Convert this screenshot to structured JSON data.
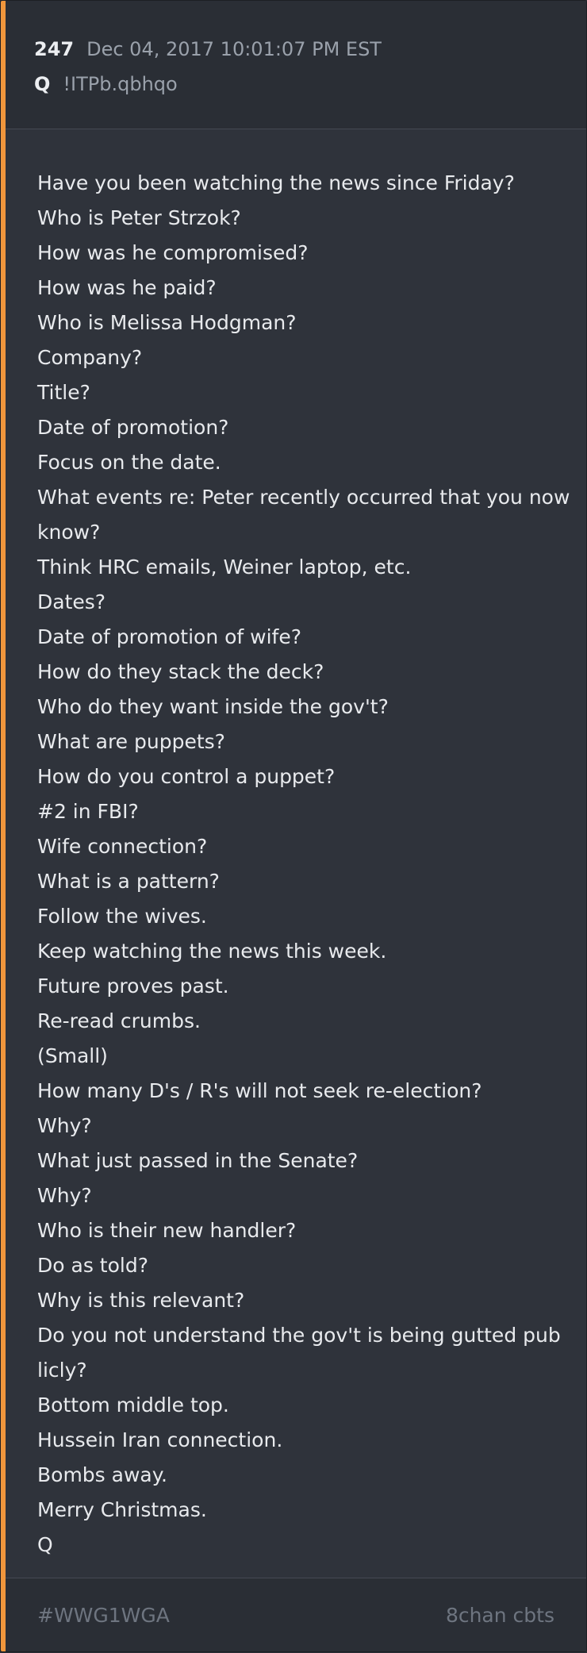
{
  "post": {
    "number": "247",
    "timestamp": "Dec 04, 2017 10:01:07 PM EST",
    "author": "Q",
    "tripcode": "!ITPb.qbhqo",
    "lines": [
      "Have you been watching the news since Friday?",
      "Who is Peter Strzok?",
      "How was he compromised?",
      "How was he paid?",
      "Who is Melissa Hodgman?",
      "Company?",
      "Title?",
      "Date of promotion?",
      "Focus on the date.",
      "What events re: Peter recently occurred that you now",
      "know?",
      "Think HRC emails, Weiner laptop, etc.",
      "Dates?",
      "Date of promotion of wife?",
      "How do they stack the deck?",
      "Who do they want inside the gov't?",
      "What are puppets?",
      "How do you control a puppet?",
      "#2 in FBI?",
      "Wife connection?",
      "What is a pattern?",
      "Follow the wives.",
      "Keep watching the news this week.",
      "Future proves past.",
      "Re-read crumbs.",
      "(Small)",
      "How many D's / R's will not seek re-election?",
      "Why?",
      "What just passed in the Senate?",
      "Why?",
      "Who is their new handler?",
      "Do as told?",
      "Why is this relevant?",
      "Do you not understand the gov't is being gutted pub",
      "licly?",
      "Bottom middle top.",
      "Hussein Iran connection.",
      "Bombs away.",
      "Merry Christmas.",
      "Q"
    ]
  },
  "footer": {
    "hashtag": "#WWG1WGA",
    "source": "8chan cbts"
  },
  "colors": {
    "accent": "#f0963c",
    "card_bg": "#2f333b",
    "header_bg": "#2a2e35",
    "text": "#e8eaed",
    "muted": "#9aa1ab"
  }
}
